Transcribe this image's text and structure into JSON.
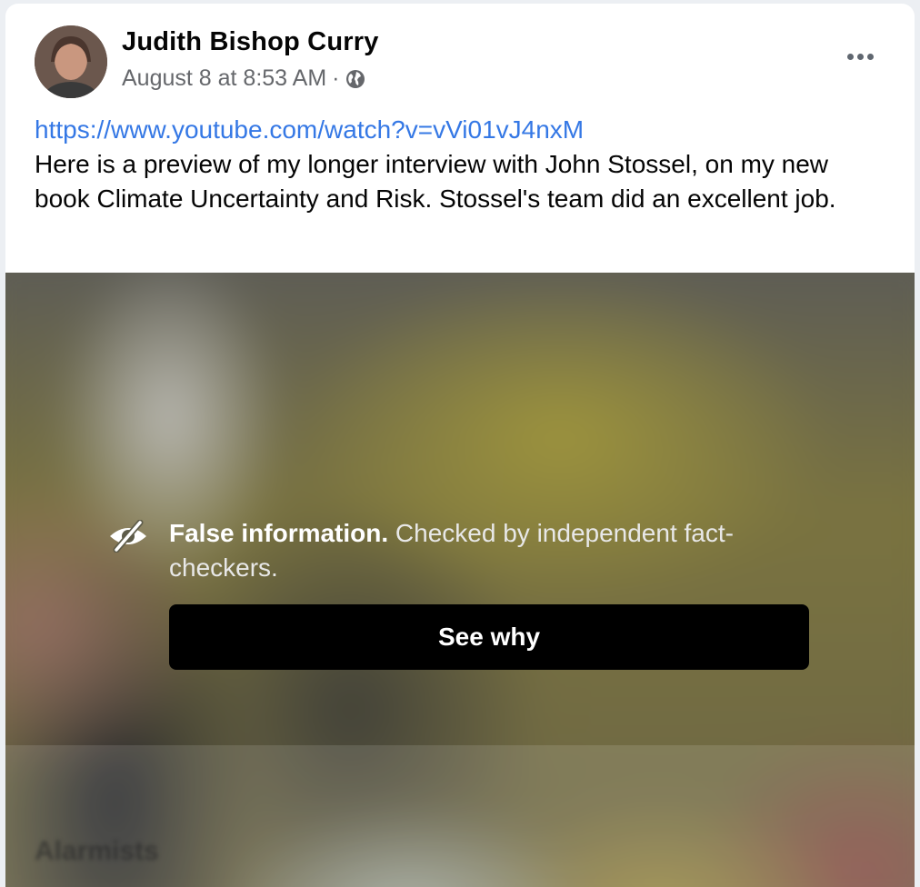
{
  "post": {
    "author": "Judith Bishop Curry",
    "timestamp": "August 8 at 8:53 AM",
    "separator": "·",
    "privacy_icon": "globe-icon",
    "more_icon": "more-horizontal-icon",
    "link": "https://www.youtube.com/watch?v=vVi01vJ4nxM",
    "body": "Here is a preview of my longer interview with John Stossel, on my new book Climate Uncertainty and Risk. Stossel's team did an excellent job."
  },
  "media": {
    "blurred_title": "Alarmists"
  },
  "fact_check": {
    "icon": "eye-slash-icon",
    "label_bold": "False information.",
    "label_rest": " Checked by independent fact-checkers.",
    "button_label": "See why"
  },
  "colors": {
    "link": "#3578e5",
    "button_bg": "#000000",
    "meta": "#65676b"
  }
}
